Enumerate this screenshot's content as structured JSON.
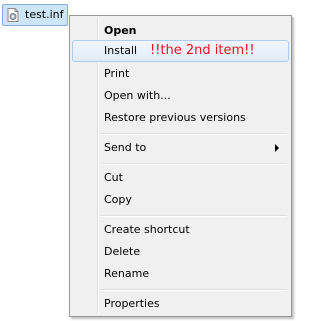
{
  "file": {
    "name": "test.inf",
    "icon": "settings-file-icon"
  },
  "menu": {
    "items": [
      {
        "label": "Open",
        "bold": true
      },
      {
        "label": "Install",
        "hovered": true,
        "annotation": "!!the 2nd item!!"
      },
      {
        "label": "Print"
      },
      {
        "label": "Open with..."
      },
      {
        "label": "Restore previous versions"
      },
      {
        "label": "Send to",
        "submenu": true
      },
      {
        "label": "Cut"
      },
      {
        "label": "Copy"
      },
      {
        "label": "Create shortcut"
      },
      {
        "label": "Delete"
      },
      {
        "label": "Rename"
      },
      {
        "label": "Properties"
      }
    ]
  },
  "colors": {
    "annotation": "#e8161b",
    "selection": "#cde6f7"
  }
}
